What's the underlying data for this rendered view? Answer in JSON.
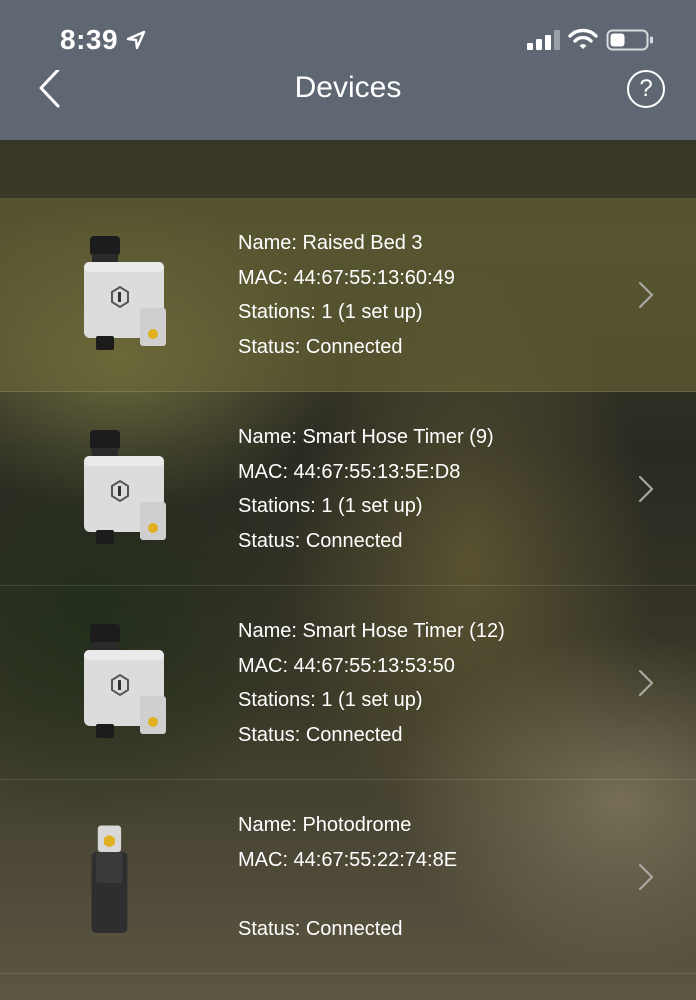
{
  "status_bar": {
    "time": "8:39",
    "icons": [
      "location-arrow-icon",
      "cellular-signal-icon",
      "wifi-icon",
      "battery-icon"
    ]
  },
  "nav": {
    "title": "Devices",
    "back_icon": "chevron-left-icon",
    "help_label": "?"
  },
  "devices": [
    {
      "name": "Name: Raised Bed 3",
      "mac": "MAC: 44:67:55:13:60:49",
      "stations": "Stations: 1 (1 set up)",
      "status": "Status: Connected",
      "image": "hose-timer-image",
      "selected": true
    },
    {
      "name": "Name: Smart Hose Timer (9)",
      "mac": "MAC: 44:67:55:13:5E:D8",
      "stations": "Stations: 1 (1 set up)",
      "status": "Status: Connected",
      "image": "hose-timer-image",
      "selected": false
    },
    {
      "name": "Name: Smart Hose Timer (12)",
      "mac": "MAC: 44:67:55:13:53:50",
      "stations": "Stations: 1 (1 set up)",
      "status": "Status: Connected",
      "image": "hose-timer-image",
      "selected": false
    },
    {
      "name": "Name: Photodrome",
      "mac": "MAC: 44:67:55:22:74:8E",
      "status": "Status: Connected",
      "image": "photodrome-bridge-image",
      "selected": false
    }
  ],
  "colors": {
    "bar_background": "#5f6872",
    "text": "#ffffff",
    "chevron": "#a8a8a0",
    "selected_row": "#6e6937"
  }
}
